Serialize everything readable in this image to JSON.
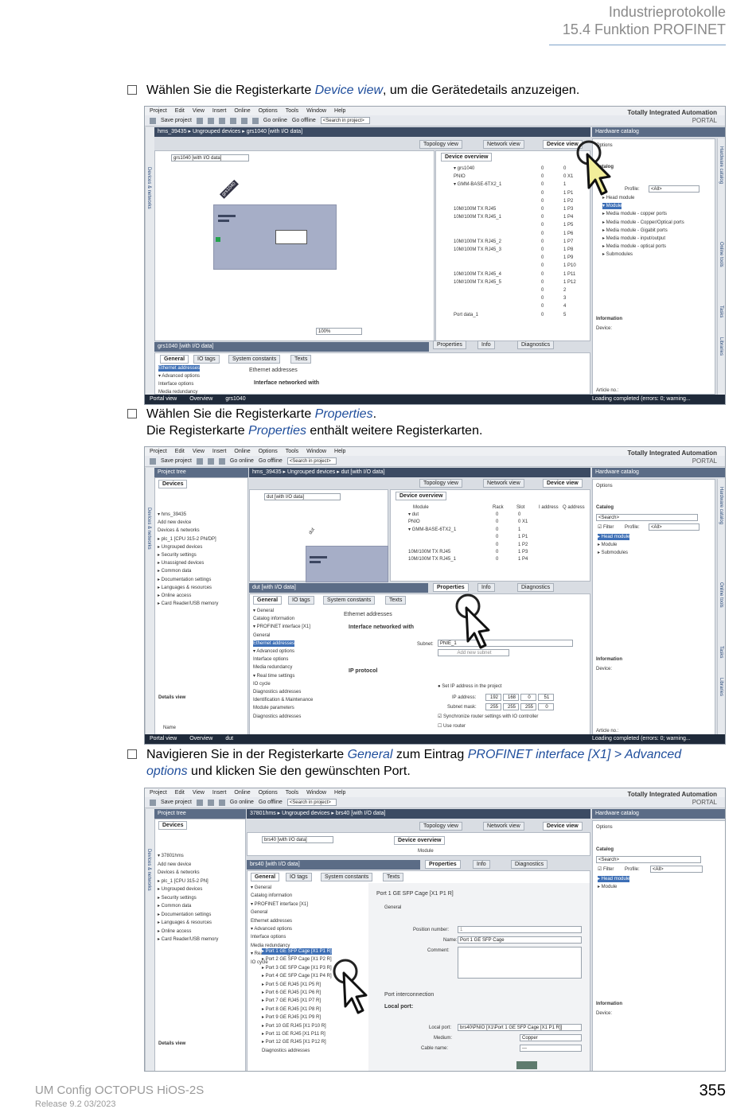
{
  "header": {
    "chapter": "Industrieprotokolle",
    "section": "15.4 Funktion PROFINET"
  },
  "steps": [
    {
      "pre": "Wählen Sie die Registerkarte ",
      "em": "Device view",
      "post": ", um die Gerätedetails anzuzeigen."
    },
    {
      "pre": "Wählen Sie die Registerkarte ",
      "em": "Properties",
      "post": ".",
      "line2_pre": "Die Registerkarte ",
      "line2_em": "Properties",
      "line2_post": " enthält weitere Registerkarten."
    },
    {
      "pre": "Navigieren Sie in der Registerkarte ",
      "em": "General",
      "mid": " zum Eintrag ",
      "em2": "PROFINET interface [X1] > Advanced options",
      "post": " und klicken Sie den gewünschten Port."
    }
  ],
  "app": {
    "menu": [
      "Project",
      "Edit",
      "View",
      "Insert",
      "Online",
      "Options",
      "Tools",
      "Window",
      "Help"
    ],
    "save_label": "Save project",
    "go_online": "Go online",
    "go_offline": "Go offline",
    "search_placeholder": "<Search in project>",
    "brand_line1": "Totally Integrated Automation",
    "brand_line2": "PORTAL",
    "view_tabs": {
      "topology": "Topology view",
      "network": "Network view",
      "device": "Device view"
    },
    "hardware_catalog": "Hardware catalog",
    "options": "Options",
    "catalog": "Catalog",
    "information": "Information",
    "device_label": "Device:",
    "properties": "Properties",
    "info": "Info",
    "diagnostics": "Diagnostics",
    "prop_tabs": {
      "general": "General",
      "io_tags": "IO tags",
      "system_constants": "System constants",
      "texts": "Texts"
    },
    "device_overview": "Device overview",
    "portal_view": "Portal view",
    "overview": "Overview",
    "project_tree": "Project tree",
    "devices": "Devices",
    "details_view": "Details view",
    "name_col": "Name",
    "search_text": "<Search>",
    "filter_label": "Filter",
    "profile_label": "Profile:",
    "profile_value": "<All>",
    "article_no": "Article no.:",
    "overview_cols": [
      "Module",
      "Rack",
      "Slot",
      "I address",
      "Q address"
    ]
  },
  "shot1": {
    "breadcrumb": "hms_39435 ▸ Ungrouped devices ▸ grs1040 [with I/O data]",
    "device_select": "grs1040 [with I/O data]",
    "device_name": "grs1040",
    "zoom": "100%",
    "props_title": "grs1040 [with I/O data]",
    "nav_items": [
      "Ethernet addresses",
      "▾ Advanced options",
      "Interface options",
      "Media redundancy"
    ],
    "section_ethernet": "Ethernet addresses",
    "section_interface": "Interface networked with",
    "status": "Loading completed (errors: 0; warning...",
    "device_tab": "grs1040",
    "modules": [
      {
        "name": "▾ grs1040",
        "rack": "0",
        "slot": "0"
      },
      {
        "name": "PNIO",
        "rack": "0",
        "slot": "0 X1"
      },
      {
        "name": "▾ GMM-BASE-6TX2_1",
        "rack": "0",
        "slot": "1"
      },
      {
        "name": "",
        "rack": "0",
        "slot": "1 P1"
      },
      {
        "name": "",
        "rack": "0",
        "slot": "1 P2"
      },
      {
        "name": "10M/100M TX RJ45",
        "rack": "0",
        "slot": "1 P3"
      },
      {
        "name": "10M/100M TX RJ45_1",
        "rack": "0",
        "slot": "1 P4"
      },
      {
        "name": "",
        "rack": "0",
        "slot": "1 P5"
      },
      {
        "name": "",
        "rack": "0",
        "slot": "1 P6"
      },
      {
        "name": "10M/100M TX RJ45_2",
        "rack": "0",
        "slot": "1 P7"
      },
      {
        "name": "10M/100M TX RJ45_3",
        "rack": "0",
        "slot": "1 P8"
      },
      {
        "name": "",
        "rack": "0",
        "slot": "1 P9"
      },
      {
        "name": "",
        "rack": "0",
        "slot": "1 P10"
      },
      {
        "name": "10M/100M TX RJ45_4",
        "rack": "0",
        "slot": "1 P11"
      },
      {
        "name": "10M/100M TX RJ45_5",
        "rack": "0",
        "slot": "1 P12"
      },
      {
        "name": "",
        "rack": "0",
        "slot": "2"
      },
      {
        "name": "",
        "rack": "0",
        "slot": "3"
      },
      {
        "name": "",
        "rack": "0",
        "slot": "4"
      },
      {
        "name": "Port data_1",
        "rack": "0",
        "slot": "5"
      }
    ],
    "catalog_items": [
      "▸ Head module",
      "▾ Module",
      "▸ Media module - copper ports",
      "▸ Media module - Copper/Optical ports",
      "▸ Media module - Gigabit ports",
      "▸ Media module - input/output",
      "▸ Media module - optical ports",
      "▸ Submodules"
    ],
    "side_tabs": [
      "Hardware catalog",
      "Online tools",
      "Tasks",
      "Libraries"
    ]
  },
  "shot2": {
    "breadcrumb": "hms_39435 ▸ Ungrouped devices ▸ dut [with I/O data]",
    "device_select": "dut [with I/O data]",
    "device_name": "dut",
    "props_title": "dut [with I/O data]",
    "tree": [
      "▾ hms_39435",
      "Add new device",
      "Devices & networks",
      "▸ plc_1 [CPU 315-2 PN/DP]",
      "▸ Ungrouped devices",
      "▸ Security settings",
      "▸ Unassigned devices",
      "▸ Common data",
      "▸ Documentation settings",
      "▸ Languages & resources",
      "▸ Online access",
      "▸ Card Reader/USB memory"
    ],
    "modules": [
      {
        "name": "▾ dut",
        "rack": "0",
        "slot": "0"
      },
      {
        "name": "PNIO",
        "rack": "0",
        "slot": "0 X1"
      },
      {
        "name": "▾ GMM-BASE-6TX2_1",
        "rack": "0",
        "slot": "1"
      },
      {
        "name": "",
        "rack": "0",
        "slot": "1 P1"
      },
      {
        "name": "",
        "rack": "0",
        "slot": "1 P2"
      },
      {
        "name": "10M/100M TX RJ45",
        "rack": "0",
        "slot": "1 P3"
      },
      {
        "name": "10M/100M TX RJ45_1",
        "rack": "0",
        "slot": "1 P4"
      }
    ],
    "nav": [
      "▾ General",
      "Catalog information",
      "▾ PROFINET interface [X1]",
      "General",
      "Ethernet addresses",
      "▾ Advanced options",
      "Interface options",
      "Media redundancy",
      "▾ Real time settings",
      "IO cycle",
      "Diagnostics addresses",
      "Identification & Maintenance",
      "Module parameters",
      "Diagnostics addresses"
    ],
    "ethernet_addresses": "Ethernet addresses",
    "interface_networked": "Interface networked with",
    "subnet_label": "Subnet:",
    "subnet_value": "PNIE_1",
    "add_subnet": "Add new subnet",
    "ip_protocol": "IP protocol",
    "set_ip": "Set IP address in the project",
    "ip_label": "IP address:",
    "ip_value": [
      "192",
      "168",
      "0",
      "51"
    ],
    "mask_label": "Subnet mask:",
    "mask_value": [
      "255",
      "255",
      "255",
      "0"
    ],
    "sync_router": "Synchronize router settings with IO controller",
    "use_router": "Use router",
    "catalog_items": [
      "▸ Head module",
      "▸ Module",
      "▸ Submodules"
    ],
    "status": "Loading completed (errors: 0; warning...",
    "device_tab": "dut"
  },
  "shot3": {
    "breadcrumb": "37801hms ▸ Ungrouped devices ▸ brs40 [with I/O data]",
    "device_select": "brs40 [with I/O data]",
    "props_title": "brs40 [with I/O data]",
    "tree": [
      "▾ 37801hms",
      "Add new device",
      "Devices & networks",
      "▸ plc_1 [CPU 315-2 PN]",
      "▸ Ungrouped devices",
      "▸ Security settings",
      "▸ Common data",
      "▸ Documentation settings",
      "▸ Languages & resources",
      "▸ Online access",
      "▸ Card Reader/USB memory"
    ],
    "nav": [
      "▾ General",
      "Catalog information",
      "▾ PROFINET interface [X1]",
      "General",
      "Ethernet addresses",
      "▾ Advanced options",
      "Interface options",
      "Media redundancy",
      "▾ Real time settings",
      "IO cycle"
    ],
    "ports": [
      "▸ Port 1 GE SFP Cage [X1 P1 R]",
      "▸ Port 2 GE SFP Cage [X1 P2 R]",
      "▸ Port 3 GE SFP Cage [X1 P3 R]",
      "▸ Port 4 GE SFP Cage [X1 P4 R]",
      "▸ Port 5 GE RJ45 [X1 P5 R]",
      "▸ Port 6 GE RJ45 [X1 P6 R]",
      "▸ Port 7 GE RJ45 [X1 P7 R]",
      "▸ Port 8 GE RJ45 [X1 P8 R]",
      "▸ Port 9 GE RJ45 [X1 P9 R]",
      "▸ Port 10 GE RJ45 [X1 P10 R]",
      "▸ Port 11 GE RJ45 [X1 P11 R]",
      "▸ Port 12 GE RJ45 [X1 P12 R]",
      "Diagnostics addresses"
    ],
    "port_header": "Port 1 GE SFP Cage [X1 P1 R]",
    "general": "General",
    "position_label": "Position number:",
    "position_value": "1",
    "name_label": "Name:",
    "name_value": "Port 1 GE SFP Cage",
    "comment_label": "Comment:",
    "port_interconnection": "Port interconnection",
    "local_port_title": "Local port:",
    "local_port_label": "Local port:",
    "local_port_value": "brs40\\PNIO [X1\\Port 1 GE SFP Cage [X1 P1 R]]",
    "medium_label": "Medium:",
    "medium_value": "Copper",
    "cable_label": "Cable name:",
    "cable_value": "---",
    "catalog_items": [
      "▸ Head module",
      "▸ Module"
    ]
  },
  "footer": {
    "title": "UM Config OCTOPUS HiOS-2S",
    "release": "Release 9.2 03/2023",
    "page": "355"
  }
}
